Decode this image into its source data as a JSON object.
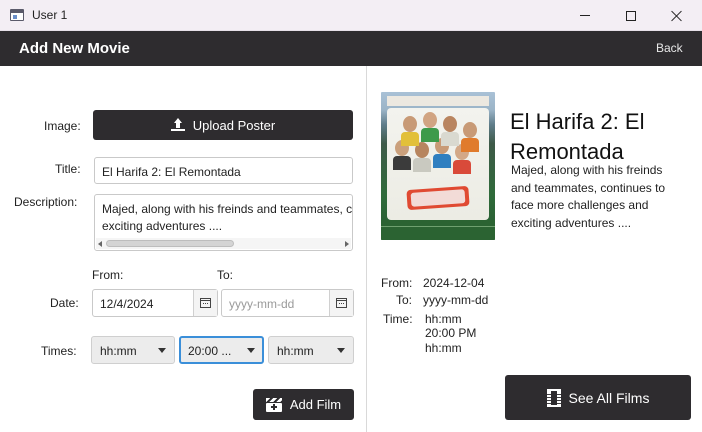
{
  "window": {
    "title": "User 1"
  },
  "header": {
    "title": "Add New Movie",
    "back_label": "Back"
  },
  "form": {
    "image_label": "Image:",
    "upload_button_label": "Upload Poster",
    "title_label": "Title:",
    "title_value": "El Harifa 2: El Remontada",
    "description_label": "Description:",
    "description_value": "Majed, along with his freinds and teammates, continues to face more challenges and exciting adventures ....",
    "description_line1": "Majed, along with his freinds and teammates, co",
    "description_line2": "exciting adventures ....",
    "from_label": "From:",
    "to_label": "To:",
    "date_label": "Date:",
    "date_from_value": "12/4/2024",
    "date_to_placeholder": "yyyy-mm-dd",
    "times_label": "Times:",
    "time_selects": [
      {
        "value": "hh:mm"
      },
      {
        "value": "20:00 ..."
      },
      {
        "value": "hh:mm"
      }
    ],
    "add_button_label": "Add Film"
  },
  "preview": {
    "title": "El Harifa 2: El Remontada",
    "description": "Majed, along with his freinds and teammates, continues to face more challenges and exciting adventures ....",
    "from_label": "From:",
    "from_value": "2024-12-04",
    "to_label": "To:",
    "to_value": "yyyy-mm-dd",
    "time_label": "Time:",
    "times": [
      "hh:mm",
      "20:00 PM",
      "hh:mm"
    ],
    "see_all_label": "See All Films"
  },
  "colors": {
    "header_bg": "#2e2c2f",
    "button_bg": "#2e2c2f",
    "focus_border": "#3b8fd9"
  }
}
